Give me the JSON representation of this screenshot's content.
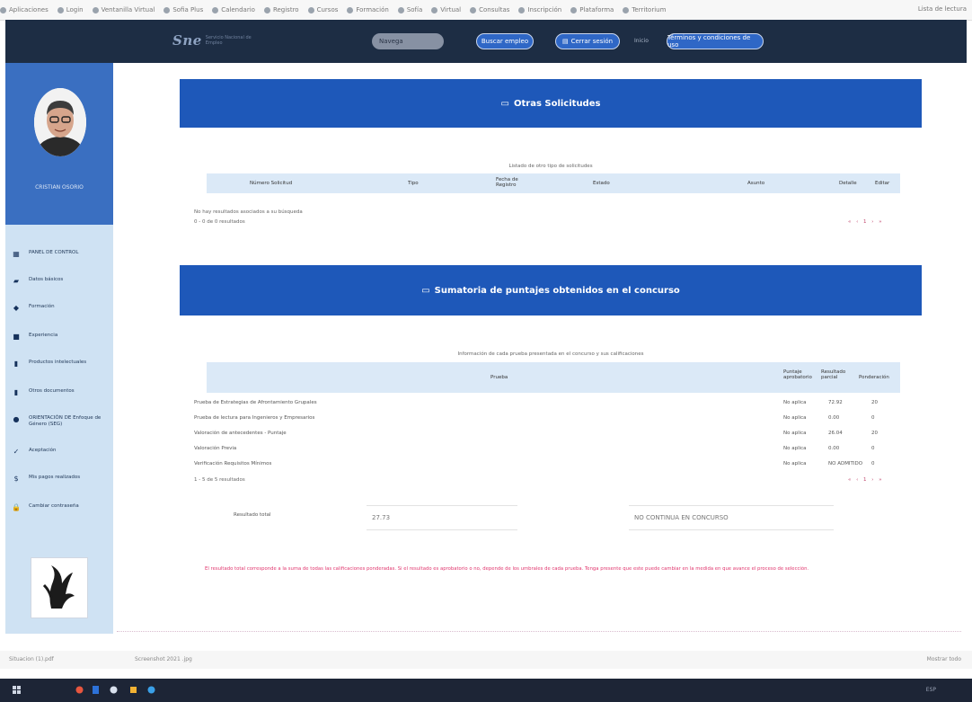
{
  "bookmarks": [
    "Aplicaciones",
    "Login",
    "Ventanilla Virtual",
    "Sofia Plus",
    "Calendario",
    "Registro",
    "Cursos",
    "Formación",
    "Sofía",
    "Virtual",
    "Consultas",
    "Inscripción",
    "Plataforma",
    "Territorium"
  ],
  "bookmarks_right": "Lista de lectura",
  "header": {
    "logo_mark": "Sne",
    "logo_text": "Servicio Nacional de Empleo",
    "search_value": "Navega",
    "search_button": "Buscar empleo",
    "logout_button": "Cerrar sesión",
    "small_label": "Inicio",
    "terms_button": "Términos y condiciones de uso"
  },
  "sidebar": {
    "profile_name": "CRISTIAN OSORIO",
    "menu": [
      {
        "label": "PANEL DE CONTROL",
        "icon": "dashboard-icon",
        "glyph": "▦"
      },
      {
        "label": "Datos básicos",
        "icon": "user-card-icon",
        "glyph": "▰"
      },
      {
        "label": "Formación",
        "icon": "graduation-icon",
        "glyph": "◆"
      },
      {
        "label": "Experiencia",
        "icon": "briefcase-icon",
        "glyph": "■"
      },
      {
        "label": "Productos intelectuales",
        "icon": "book-icon",
        "glyph": "▮"
      },
      {
        "label": "Otros documentos",
        "icon": "document-icon",
        "glyph": "▮"
      },
      {
        "label": "ORIENTACIÓN DE Enfoque de Género (SEG)",
        "icon": "globe-icon",
        "glyph": "●"
      },
      {
        "label": "Aceptación",
        "icon": "handshake-icon",
        "glyph": "✓"
      },
      {
        "label": "Mis pagos realizados",
        "icon": "dollar-icon",
        "glyph": "$"
      },
      {
        "label": "Cambiar contraseña",
        "icon": "lock-icon",
        "glyph": "🔒"
      }
    ]
  },
  "section1": {
    "title": "Otras Solicitudes",
    "caption": "Listado de otro tipo de solicitudes",
    "columns": [
      "Número Solicitud",
      "Tipo",
      "Fecha de Registro",
      "Estado",
      "Asunto",
      "Detalle",
      "Editar"
    ],
    "empty_message": "No hay resultados asociados a su búsqueda",
    "count": "0 - 0 de 0 resultados",
    "pager": "« ‹ 1 › »"
  },
  "section2": {
    "title": "Sumatoria de puntajes obtenidos en el concurso",
    "caption": "Información de cada prueba presentada en el concurso y sus calificaciones",
    "columns": [
      "Prueba",
      "Puntaje aprobatorio",
      "Resultado parcial",
      "Ponderación"
    ],
    "rows": [
      {
        "prueba": "Prueba de Estrategias de Afrontamiento Grupales",
        "aprob": "No aplica",
        "parcial": "72.92",
        "pond": "20"
      },
      {
        "prueba": "Prueba de lectura para Ingenieros y Empresarios",
        "aprob": "No aplica",
        "parcial": "0.00",
        "pond": "0"
      },
      {
        "prueba": "Valoración de antecedentes - Puntaje",
        "aprob": "No aplica",
        "parcial": "26.04",
        "pond": "20"
      },
      {
        "prueba": "Valoración Previa",
        "aprob": "No aplica",
        "parcial": "0.00",
        "pond": "0"
      },
      {
        "prueba": "Verificación Requisitos Mínimos",
        "aprob": "No aplica",
        "parcial": "NO ADMITIDO",
        "pond": "0"
      }
    ],
    "count": "1 - 5 de 5 resultados",
    "pager": "« ‹ 1 › »",
    "result_label": "Resultado total",
    "result_value": "27.73",
    "status": "NO CONTINUA EN CONCURSO",
    "disclaimer": "El resultado total corresponde a la suma de todas las calificaciones ponderadas. Si el resultado es aprobatorio o no, depende de los umbrales de cada prueba. Tenga presente que este puede cambiar en la medida en que avance el proceso de selección."
  },
  "shelf": {
    "item1": "Situacion (1).pdf",
    "item2": "Screenshot 2021 .jpg",
    "right": "Mostrar todo"
  },
  "taskbar": {
    "right": "ESP"
  }
}
